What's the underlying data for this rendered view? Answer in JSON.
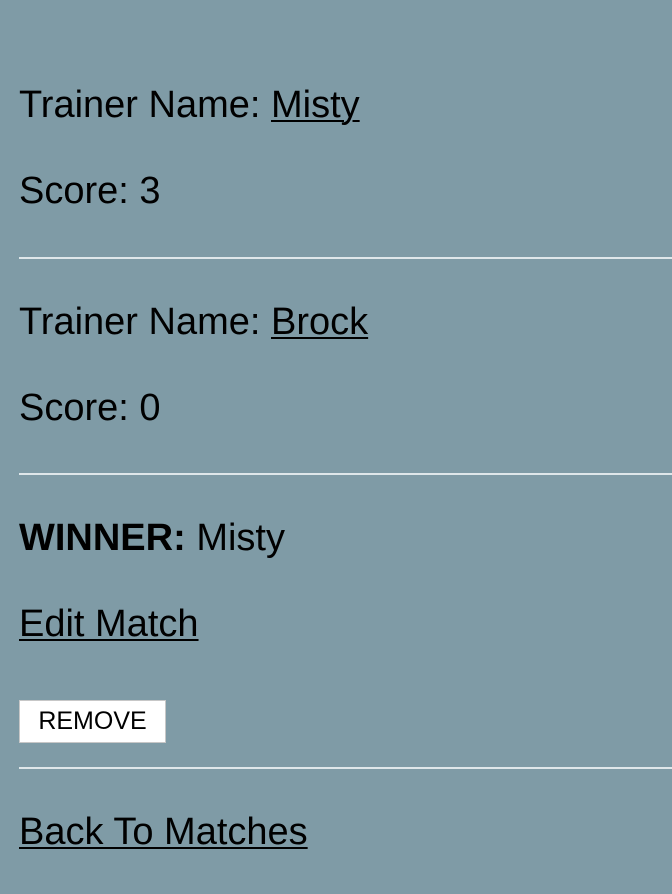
{
  "trainers": [
    {
      "name_label": "Trainer Name: ",
      "name": "Misty",
      "score_label": "Score: ",
      "score": "3"
    },
    {
      "name_label": "Trainer Name: ",
      "name": "Brock",
      "score_label": "Score: ",
      "score": "0"
    }
  ],
  "winner": {
    "label": "WINNER:",
    "name": "Misty"
  },
  "actions": {
    "edit_label": "Edit Match",
    "remove_label": "REMOVE",
    "back_label": "Back To Matches"
  },
  "colors": {
    "background": "#7f9ba6",
    "divider": "#dfe7ea"
  }
}
